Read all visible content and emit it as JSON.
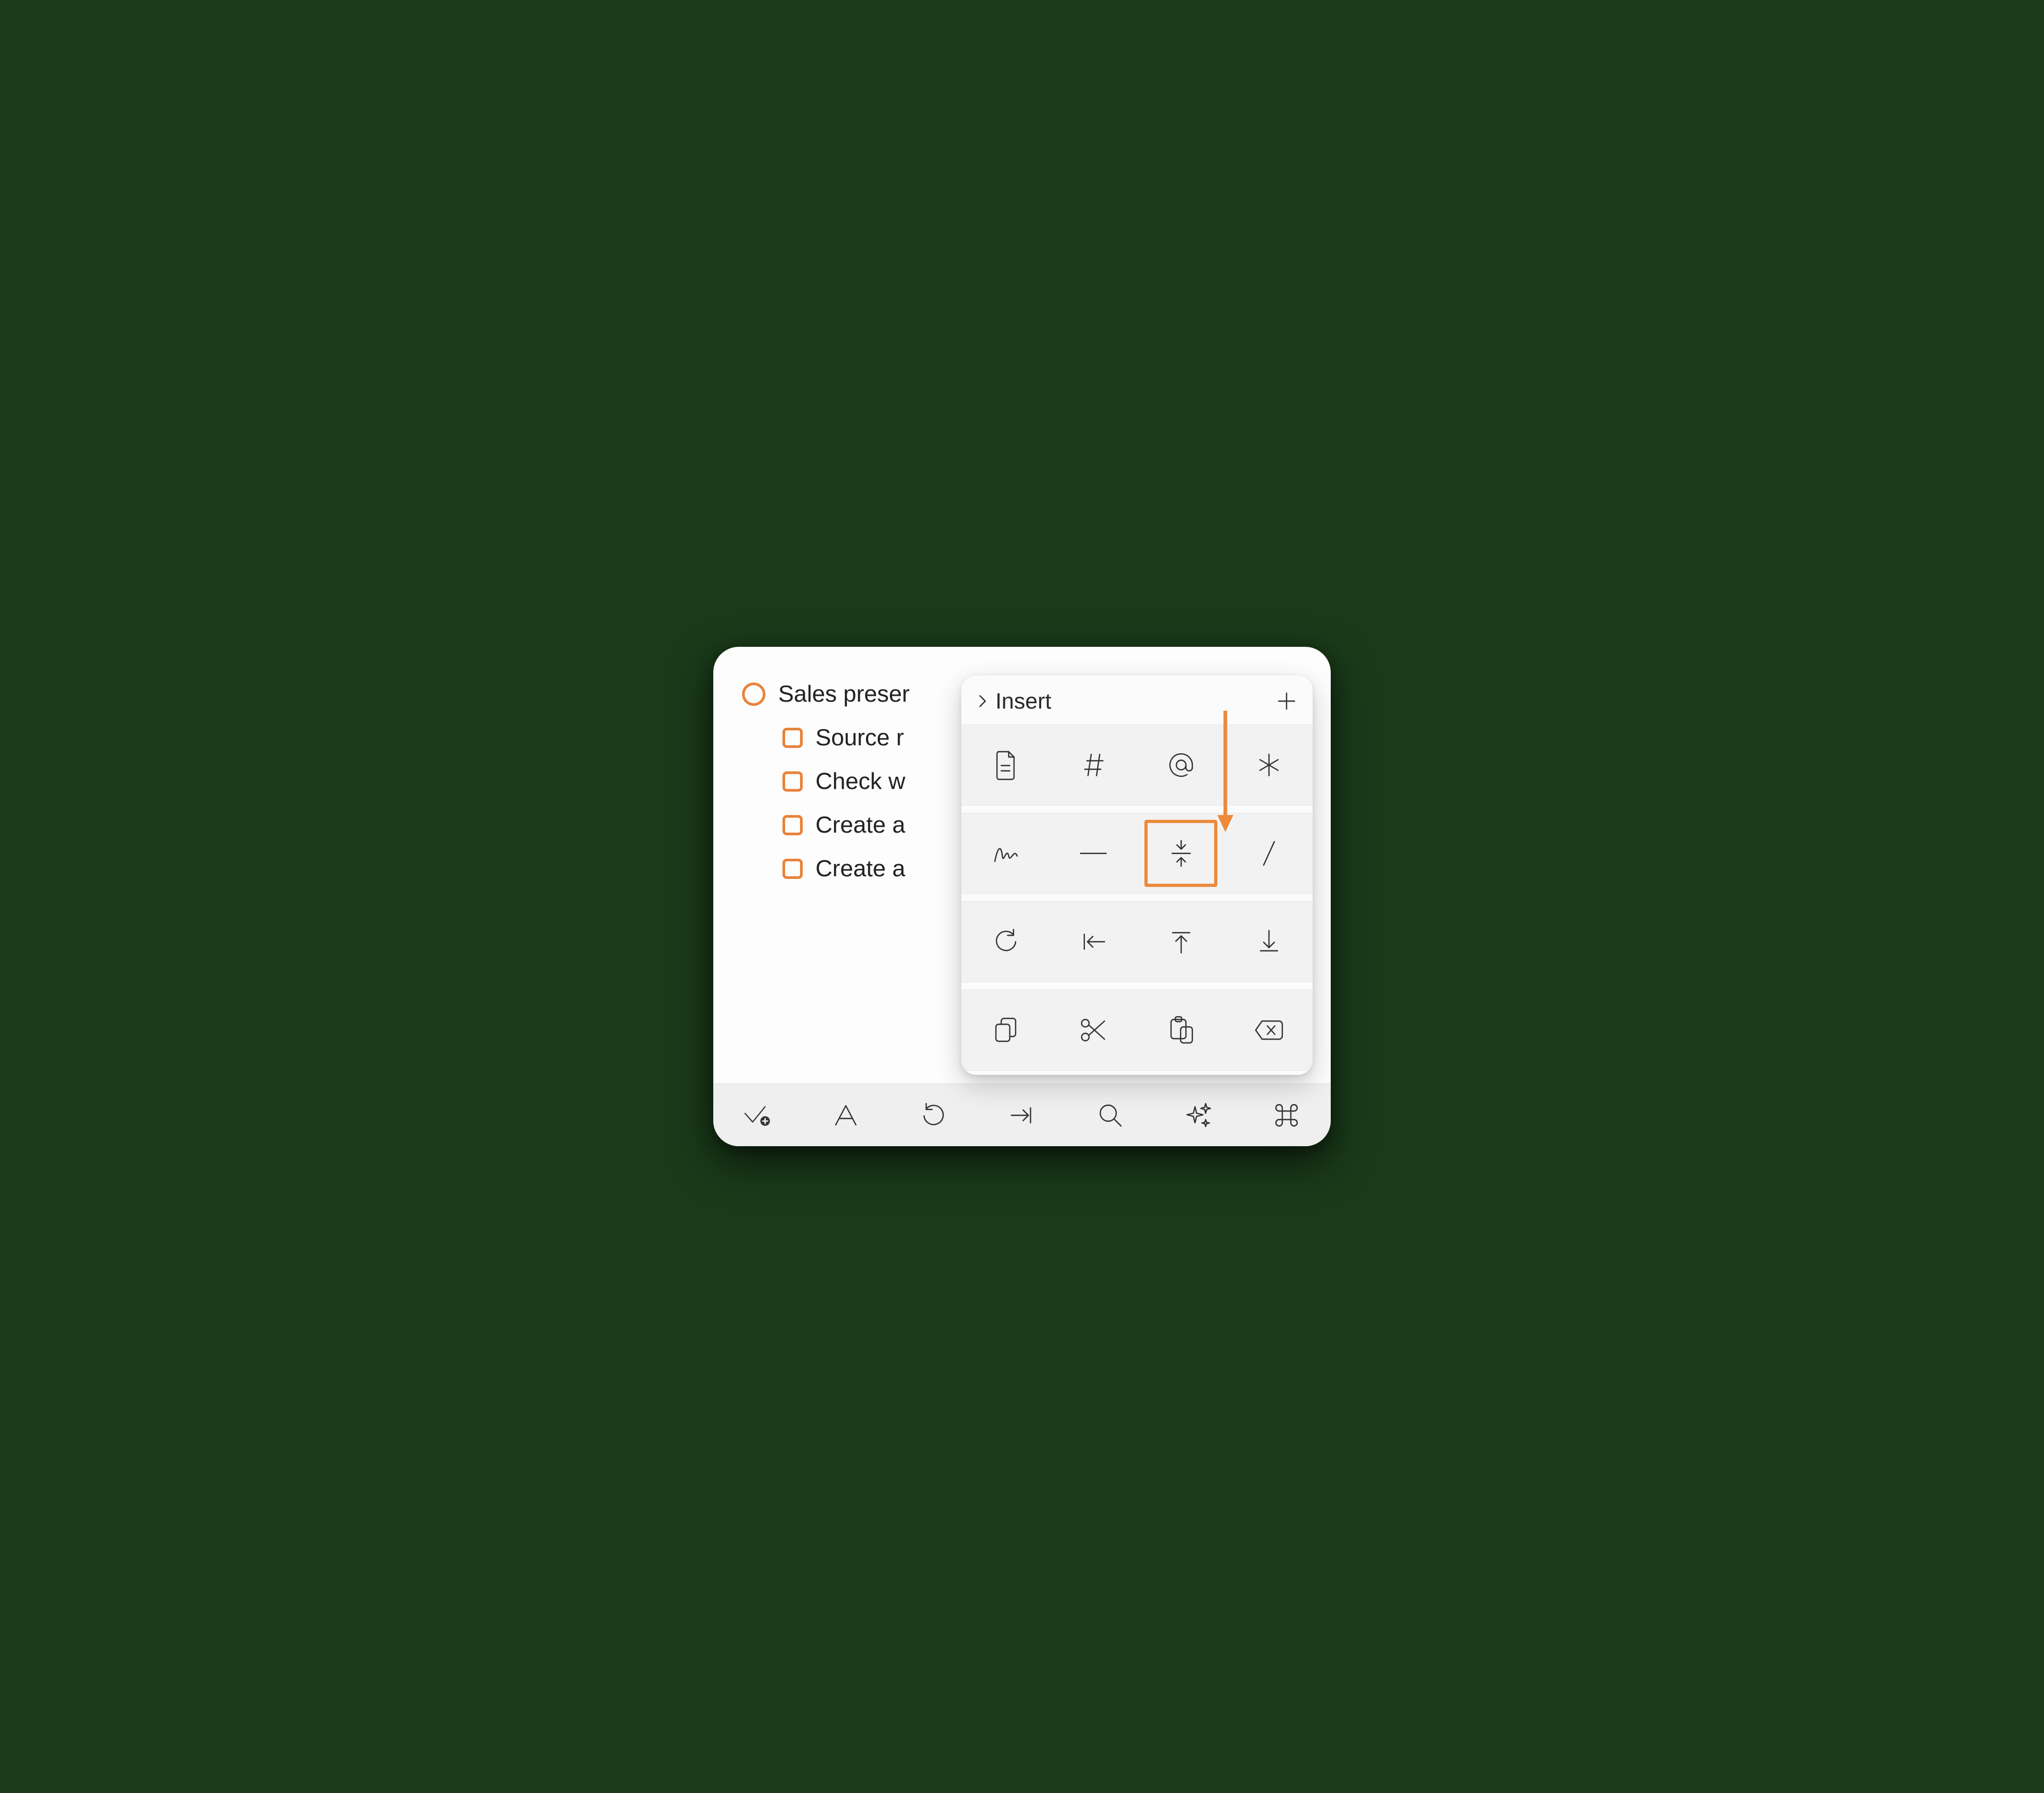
{
  "outline": {
    "parent_label": "Sales preser",
    "children": [
      "Source r",
      "Check w",
      "Create a",
      "Create a"
    ]
  },
  "insert_panel": {
    "title": "Insert",
    "highlighted_cell": "fold-icon",
    "groups": [
      [
        "document-icon",
        "hash-icon",
        "at-icon",
        "asterisk-icon"
      ],
      [
        "scribble-icon",
        "horizontal-rule-icon",
        "fold-icon",
        "slash-icon"
      ],
      [
        "redo-icon",
        "move-to-start-icon",
        "move-up-icon",
        "move-down-icon"
      ],
      [
        "copy-icon",
        "cut-icon",
        "paste-icon",
        "delete-icon"
      ]
    ]
  },
  "bottom_toolbar": [
    "check-add-icon",
    "text-style-icon",
    "undo-icon",
    "indent-icon",
    "search-icon",
    "sparkle-icon",
    "command-icon"
  ],
  "colors": {
    "accent": "#ec8a3b",
    "panel_bg": "#f2f2f2"
  }
}
